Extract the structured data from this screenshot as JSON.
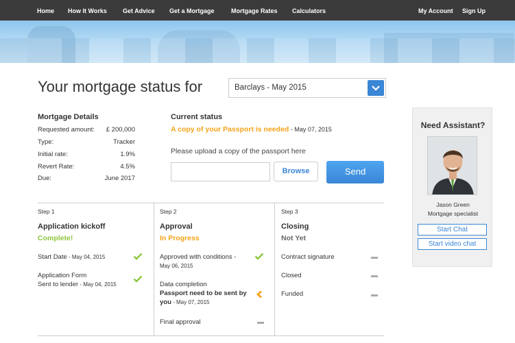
{
  "nav": {
    "items": [
      "Home",
      "How It Works",
      "Get Advice",
      "Get a Mortgage",
      "Mortgage Rates",
      "Calculators"
    ],
    "account": "My Account",
    "signup": "Sign Up"
  },
  "page": {
    "title": "Your mortgage status for",
    "selected_mortgage": "Barclays - May 2015"
  },
  "details": {
    "heading": "Mortgage Details",
    "rows": [
      {
        "label": "Requested amount:",
        "value": "£ 200,000"
      },
      {
        "label": "Type:",
        "value": "Tracker"
      },
      {
        "label": "Initial rate:",
        "value": "1.9%"
      },
      {
        "label": "Revert Rate:",
        "value": "4.5%"
      },
      {
        "label": "Due:",
        "value": "June 2017"
      }
    ]
  },
  "status": {
    "heading": "Current status",
    "message": "A copy of your Passport is needed",
    "date": " - May 07, 2015",
    "upload_label": "Please upload a copy of the passport here",
    "upload_value": "",
    "browse": "Browse",
    "send": "Send"
  },
  "steps": [
    {
      "number": "Step 1",
      "name": "Application kickoff",
      "status": "Complete!",
      "items": [
        {
          "text": "Start Date",
          "date": " - May 04, 2015",
          "state": "check"
        },
        {
          "text": "Application Form",
          "text2": "Sent to lender",
          "date": " - May 04, 2015",
          "state": "check"
        }
      ]
    },
    {
      "number": "Step 2",
      "name": "Approval",
      "status": "In Progress",
      "items": [
        {
          "text": "Approved with conditions -",
          "date": "May 06, 2015",
          "state": "check"
        },
        {
          "text": "Data completion",
          "bold1": "Passport need to be sent by",
          "bold2": "you",
          "date": " - May 07, 2015",
          "state": "pending"
        },
        {
          "text": "Final approval",
          "state": "none"
        }
      ]
    },
    {
      "number": "Step 3",
      "name": "Closing",
      "status": "Not Yet",
      "items": [
        {
          "text": "Contract signature",
          "state": "none"
        },
        {
          "text": "Closed",
          "state": "none"
        },
        {
          "text": "Funded",
          "state": "none"
        }
      ]
    }
  ],
  "assistant": {
    "heading": "Need Assistant?",
    "name": "Jason Green",
    "role": "Mortgage specialist",
    "chat": "Start Chat",
    "video": "Start video chat"
  },
  "colors": {
    "accent": "#3a86d6",
    "complete": "#8dc63f",
    "in_progress": "#f5a31a",
    "nav_bg": "#3b3b3b"
  }
}
